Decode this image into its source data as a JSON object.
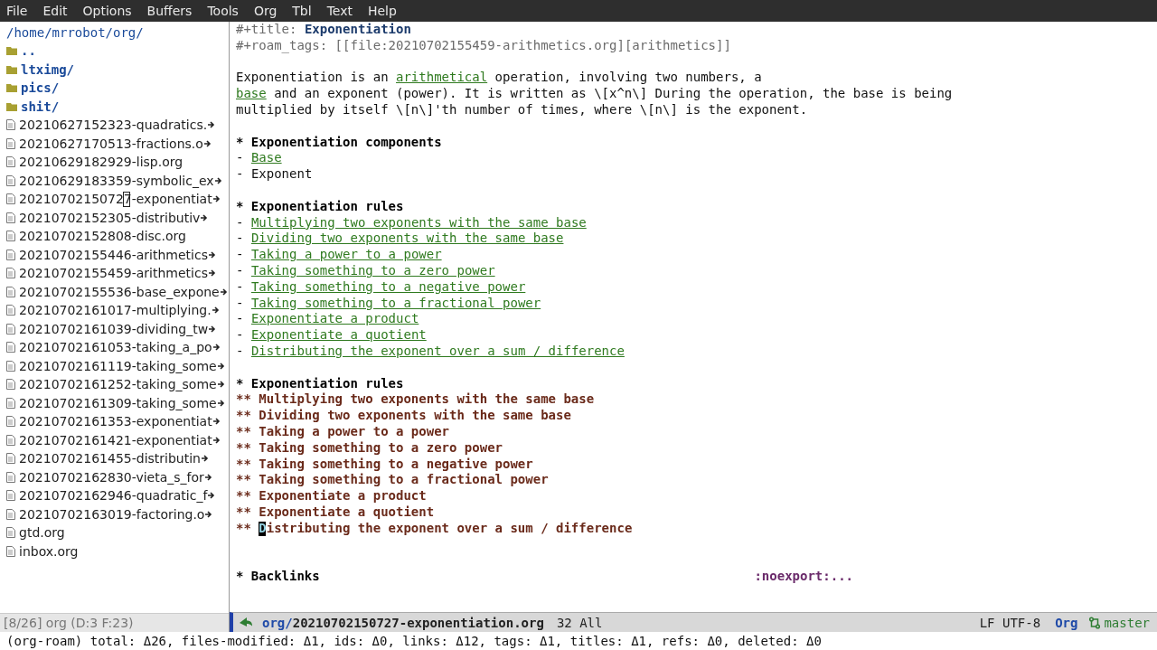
{
  "menu_bar": [
    "File",
    "Edit",
    "Options",
    "Buffers",
    "Tools",
    "Org",
    "Tbl",
    "Text",
    "Help"
  ],
  "sidebar": {
    "path": "/home/mrrobot/org/",
    "entries": [
      {
        "kind": "folder",
        "name": "..",
        "truncated": false,
        "selected": false
      },
      {
        "kind": "folder",
        "name": "ltximg/",
        "truncated": false,
        "selected": false
      },
      {
        "kind": "folder",
        "name": "pics/",
        "truncated": false,
        "selected": false
      },
      {
        "kind": "folder",
        "name": "shit/",
        "truncated": false,
        "selected": false
      },
      {
        "kind": "file",
        "name": "20210627152323-quadratics.",
        "truncated": true,
        "selected": false
      },
      {
        "kind": "file",
        "name": "20210627170513-fractions.o",
        "truncated": true,
        "selected": false
      },
      {
        "kind": "file",
        "name": "20210629182929-lisp.org",
        "truncated": false,
        "selected": false
      },
      {
        "kind": "file",
        "name": "20210629183359-symbolic_ex",
        "truncated": true,
        "selected": false
      },
      {
        "kind": "file",
        "name": "20210702150727-exponentiat",
        "truncated": true,
        "selected": true
      },
      {
        "kind": "file",
        "name": "20210702152305-distributiv",
        "truncated": true,
        "selected": false
      },
      {
        "kind": "file",
        "name": "20210702152808-disc.org",
        "truncated": false,
        "selected": false
      },
      {
        "kind": "file",
        "name": "20210702155446-arithmetics",
        "truncated": true,
        "selected": false
      },
      {
        "kind": "file",
        "name": "20210702155459-arithmetics",
        "truncated": true,
        "selected": false
      },
      {
        "kind": "file",
        "name": "20210702155536-base_expone",
        "truncated": true,
        "selected": false
      },
      {
        "kind": "file",
        "name": "20210702161017-multiplying.",
        "truncated": true,
        "selected": false
      },
      {
        "kind": "file",
        "name": "20210702161039-dividing_tw",
        "truncated": true,
        "selected": false
      },
      {
        "kind": "file",
        "name": "20210702161053-taking_a_po",
        "truncated": true,
        "selected": false
      },
      {
        "kind": "file",
        "name": "20210702161119-taking_some",
        "truncated": true,
        "selected": false
      },
      {
        "kind": "file",
        "name": "20210702161252-taking_some",
        "truncated": true,
        "selected": false
      },
      {
        "kind": "file",
        "name": "20210702161309-taking_some",
        "truncated": true,
        "selected": false
      },
      {
        "kind": "file",
        "name": "20210702161353-exponentiat",
        "truncated": true,
        "selected": false
      },
      {
        "kind": "file",
        "name": "20210702161421-exponentiat",
        "truncated": true,
        "selected": false
      },
      {
        "kind": "file",
        "name": "20210702161455-distributin",
        "truncated": true,
        "selected": false
      },
      {
        "kind": "file",
        "name": "20210702162830-vieta_s_for",
        "truncated": true,
        "selected": false
      },
      {
        "kind": "file",
        "name": "20210702162946-quadratic_f",
        "truncated": true,
        "selected": false
      },
      {
        "kind": "file",
        "name": "20210702163019-factoring.o",
        "truncated": true,
        "selected": false
      },
      {
        "kind": "file",
        "name": "gtd.org",
        "truncated": false,
        "selected": false
      },
      {
        "kind": "file",
        "name": "inbox.org",
        "truncated": false,
        "selected": false
      }
    ],
    "mode_line": "[8/26] org (D:3 F:23)"
  },
  "buffer": {
    "lines": [
      {
        "kind": "keyword",
        "key": "#+title:",
        "value": "Exponentiation"
      },
      {
        "kind": "keyword",
        "key": "#+roam_tags:",
        "value": "[[file:20210702155459-arithmetics.org][arithmetics]]"
      },
      {
        "kind": "blank"
      },
      {
        "kind": "paragraph",
        "lines": [
          [
            {
              "text": "Exponentiation is an "
            },
            {
              "text": "arithmetical",
              "link": true
            },
            {
              "text": " operation, involving two numbers, a"
            }
          ],
          [
            {
              "text": "base",
              "link": true
            },
            {
              "text": " and an exponent (power). It is written as \\[x^n\\] During the operation, the base is being"
            }
          ],
          [
            {
              "text": "multiplied by itself \\[n\\]'th number of times, where \\[n\\] is the exponent."
            }
          ]
        ]
      },
      {
        "kind": "blank"
      },
      {
        "kind": "heading",
        "marker": "*",
        "text": "Exponentiation components"
      },
      {
        "kind": "item",
        "marker": "-",
        "text": "Base",
        "link": true
      },
      {
        "kind": "item",
        "marker": "-",
        "text": "Exponent",
        "link": false
      },
      {
        "kind": "blank"
      },
      {
        "kind": "heading",
        "marker": "*",
        "text": "Exponentiation rules"
      },
      {
        "kind": "item",
        "marker": "-",
        "text": "Multiplying two exponents with the same base",
        "link": true
      },
      {
        "kind": "item",
        "marker": "-",
        "text": "Dividing two exponents with the same base",
        "link": true
      },
      {
        "kind": "item",
        "marker": "-",
        "text": "Taking a power to a power",
        "link": true
      },
      {
        "kind": "item",
        "marker": "-",
        "text": "Taking something to a zero power",
        "link": true
      },
      {
        "kind": "item",
        "marker": "-",
        "text": "Taking something to a negative power",
        "link": true
      },
      {
        "kind": "item",
        "marker": "-",
        "text": "Taking something to a fractional power",
        "link": true
      },
      {
        "kind": "item",
        "marker": "-",
        "text": "Exponentiate a product",
        "link": true
      },
      {
        "kind": "item",
        "marker": "-",
        "text": "Exponentiate a quotient",
        "link": true
      },
      {
        "kind": "item",
        "marker": "-",
        "text": "Distributing the exponent over a sum / difference",
        "link": true
      },
      {
        "kind": "blank"
      },
      {
        "kind": "heading",
        "marker": "*",
        "text": "Exponentiation rules"
      },
      {
        "kind": "subheading",
        "marker": "**",
        "text": "Multiplying two exponents with the same base",
        "cursor": false
      },
      {
        "kind": "subheading",
        "marker": "**",
        "text": "Dividing two exponents with the same base",
        "cursor": false
      },
      {
        "kind": "subheading",
        "marker": "**",
        "text": "Taking a power to a power",
        "cursor": false
      },
      {
        "kind": "subheading",
        "marker": "**",
        "text": "Taking something to a zero power",
        "cursor": false
      },
      {
        "kind": "subheading",
        "marker": "**",
        "text": "Taking something to a negative power",
        "cursor": false
      },
      {
        "kind": "subheading",
        "marker": "**",
        "text": "Taking something to a fractional power",
        "cursor": false
      },
      {
        "kind": "subheading",
        "marker": "**",
        "text": "Exponentiate a product",
        "cursor": false
      },
      {
        "kind": "subheading",
        "marker": "**",
        "text": "Exponentiate a quotient",
        "cursor": false
      },
      {
        "kind": "subheading",
        "marker": "**",
        "text": "Distributing the exponent over a sum / difference",
        "cursor": true
      },
      {
        "kind": "blank"
      },
      {
        "kind": "blank"
      },
      {
        "kind": "heading",
        "marker": "*",
        "text": "Backlinks",
        "tag": ":noexport:..."
      }
    ],
    "mode_line": {
      "directory": "org/",
      "file": "20210702150727-exponentiation.org",
      "position": "32 All",
      "encoding": "LF UTF-8",
      "mode": "Org",
      "branch": "master"
    }
  },
  "echo_area": "(org-roam) total: Δ26, files-modified: Δ1, ids: Δ0, links: Δ12, tags: Δ1, titles: Δ1, refs: Δ0, deleted: Δ0"
}
